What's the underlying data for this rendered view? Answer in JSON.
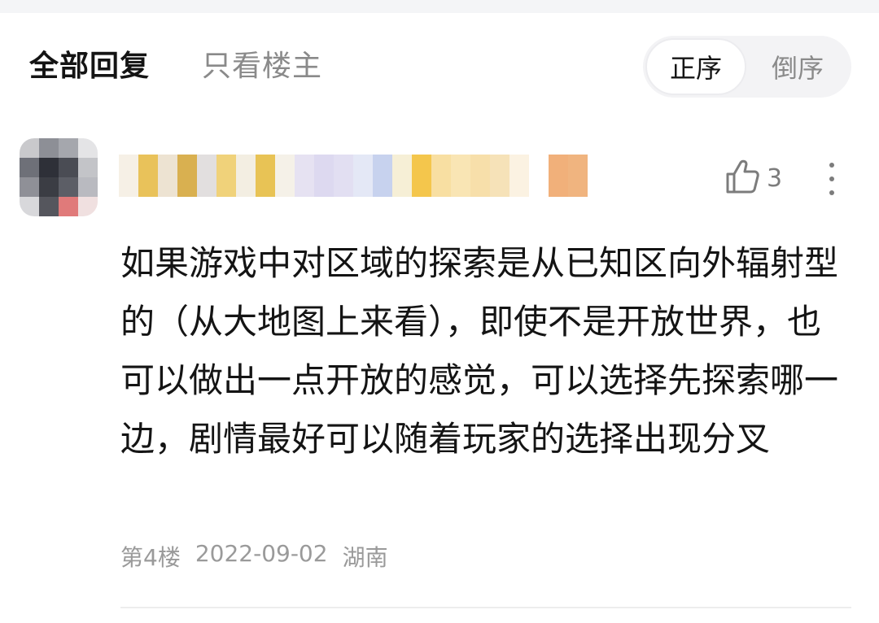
{
  "tabs": {
    "all_replies": "全部回复",
    "op_only": "只看楼主"
  },
  "sort": {
    "ascending": "正序",
    "descending": "倒序"
  },
  "reply": {
    "like_count": "3",
    "content": "如果游戏中对区域的探索是从已知区向外辐射型的（从大地图上来看），即使不是开放世界，也可以做出一点开放的感觉，可以选择先探索哪一边，剧情最好可以随着玩家的选择出现分叉",
    "floor": "第4楼",
    "date": "2022-09-02",
    "location": "湖南"
  },
  "icons": {
    "like": "thumbs-up-icon",
    "more": "more-vertical-icon"
  }
}
